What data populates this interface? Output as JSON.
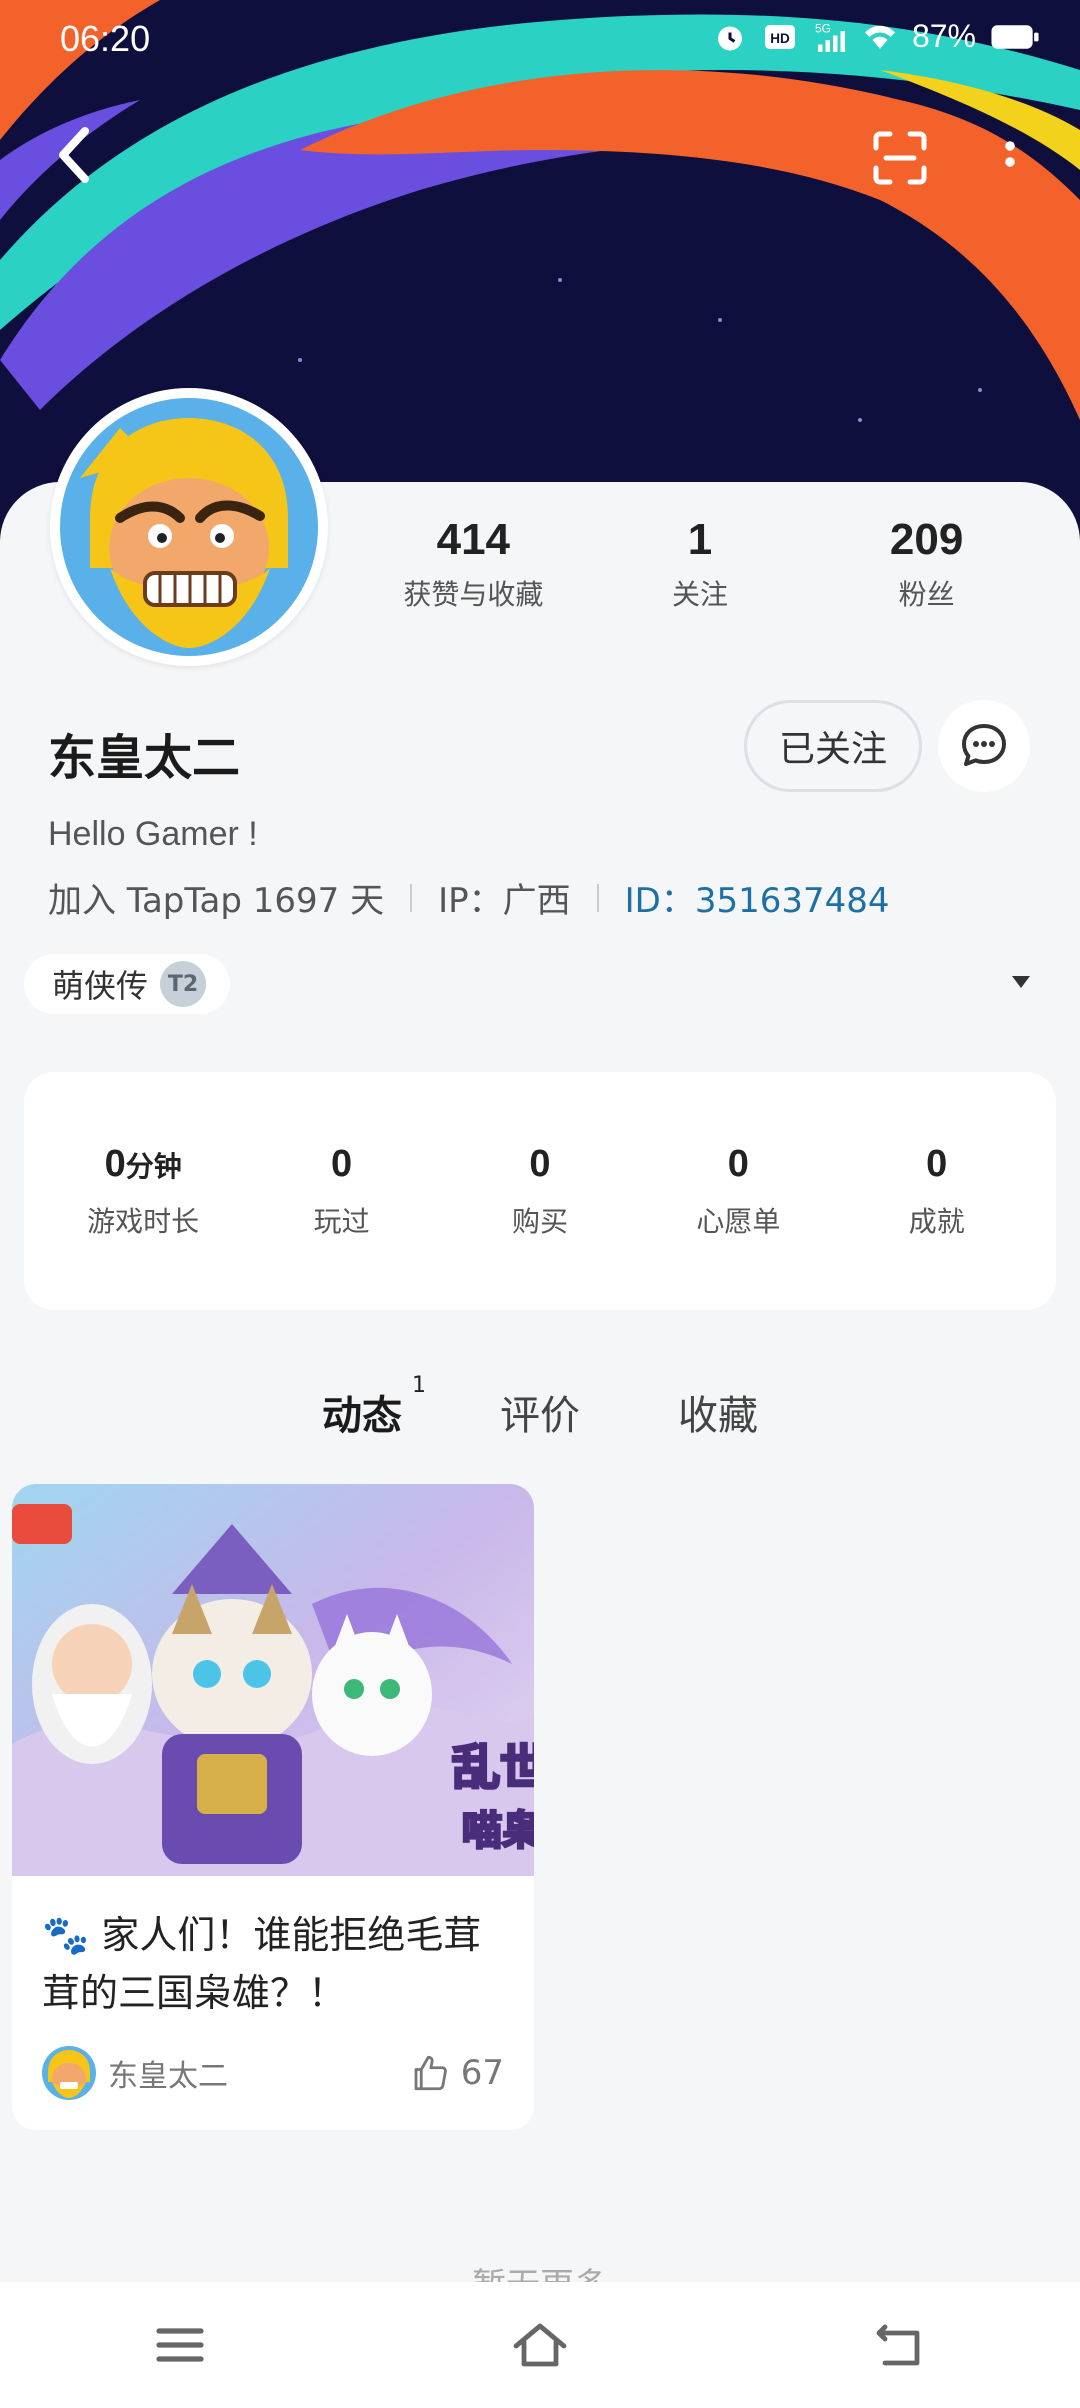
{
  "status_bar": {
    "time": "06:20",
    "battery": "87%",
    "network": "5G",
    "hd": "HD"
  },
  "profile": {
    "name": "东皇太二",
    "bio": "Hello Gamer !",
    "joined": "加入 TapTap 1697 天",
    "ip": "IP：广西",
    "id_label": "ID：",
    "id_value": "351637484",
    "follow_label": "已关注"
  },
  "stats": [
    {
      "value": "414",
      "label": "获赞与收藏"
    },
    {
      "value": "1",
      "label": "关注"
    },
    {
      "value": "209",
      "label": "粉丝"
    }
  ],
  "game_chip": {
    "name": "萌侠传",
    "badge": "T2"
  },
  "game_stats": {
    "playtime_value": "0",
    "playtime_unit": "分钟",
    "playtime_label": "游戏时长",
    "played_value": "0",
    "played_label": "玩过",
    "bought_value": "0",
    "bought_label": "购买",
    "wishlist_value": "0",
    "wishlist_label": "心愿单",
    "achievement_value": "0",
    "achievement_label": "成就"
  },
  "tabs": [
    {
      "label": "动态",
      "count": "1",
      "active": true
    },
    {
      "label": "评价"
    },
    {
      "label": "收藏"
    }
  ],
  "post": {
    "title": "🐾 家人们！谁能拒绝毛茸茸的三国枭雄？！",
    "author": "东皇太二",
    "likes": "67"
  },
  "no_more": "暂无更多",
  "icons": {
    "back": "back-arrow-icon",
    "scan": "scan-icon",
    "more": "more-vertical-icon",
    "message": "chat-bubble-icon",
    "like": "thumbs-up-icon",
    "menu": "menu-icon",
    "home": "home-icon",
    "return": "return-icon"
  },
  "colors": {
    "accent": "#15c5ce",
    "id_link": "#1d6fa5",
    "header_bg": "#0e0f3d"
  }
}
